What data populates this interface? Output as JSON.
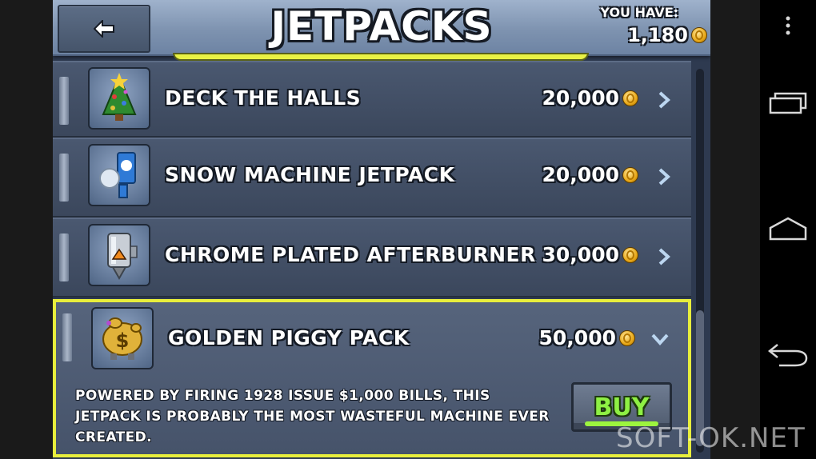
{
  "header": {
    "title": "JETPACKS",
    "you_have_label": "YOU HAVE:",
    "coins": "1,180"
  },
  "items": [
    {
      "name": "DECK THE HALLS",
      "price": "20,000",
      "icon": "christmas-tree-icon",
      "expanded": false
    },
    {
      "name": "SNOW MACHINE JETPACK",
      "price": "20,000",
      "icon": "snow-machine-icon",
      "expanded": false
    },
    {
      "name": "CHROME PLATED AFTERBURNER",
      "price": "30,000",
      "icon": "chrome-afterburner-icon",
      "expanded": false
    },
    {
      "name": "GOLDEN PIGGY PACK",
      "price": "50,000",
      "icon": "golden-piggy-icon",
      "expanded": true,
      "description": "POWERED BY FIRING 1928 ISSUE $1,000 BILLS, THIS JETPACK IS PROBABLY THE MOST WASTEFUL MACHINE EVER CREATED.",
      "buy_label": "BUY"
    }
  ],
  "watermark": "SOFT-OK.NET",
  "colors": {
    "selection_border": "#e8ee3c",
    "buy_text": "#8ef044",
    "coin": "#e8a818"
  }
}
